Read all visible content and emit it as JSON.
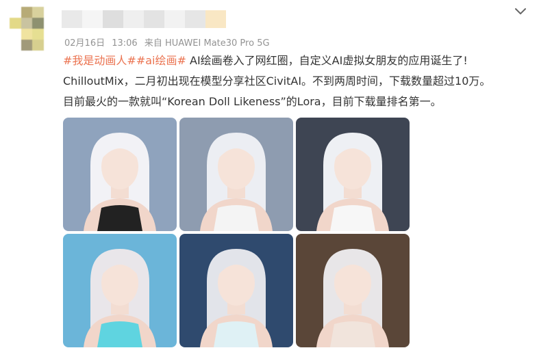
{
  "colors": {
    "tag": "#eb7350",
    "text": "#333333",
    "meta": "#939393"
  },
  "header": {
    "chevron_icon": "chevron-down-icon"
  },
  "meta": {
    "date": "02月16日",
    "time": "13:06",
    "source": "来自 HUAWEI Mate30 Pro 5G"
  },
  "post": {
    "tag1": "#我是动画人#",
    "tag2": "#ai绘画#",
    "line1_text": " AI绘画卷入了网红圈，自定义AI虚拟女朋友的应用诞生了!",
    "line2": "ChilloutMix，二月初出现在模型分享社区CivitAI。不到两周时间，下载数量超过10万。",
    "line3": "目前最火的一款就叫“Korean Doll Likeness”的Lora，目前下载量排名第一。"
  },
  "photos": [
    {
      "bg": "#8fa3bd",
      "hair": "#f2f2f6",
      "outfit": "#222222"
    },
    {
      "bg": "#8e9cb0",
      "hair": "#eceef3",
      "outfit": "#f4f4f4"
    },
    {
      "bg": "#3e4553",
      "hair": "#eef0f4",
      "outfit": "#f7f7f7"
    },
    {
      "bg": "#6bb5d9",
      "hair": "#e9e6ea",
      "outfit": "#5fd4e0"
    },
    {
      "bg": "#2f4a6e",
      "hair": "#e2e4ea",
      "outfit": "#dff1f5"
    },
    {
      "bg": "#5a4638",
      "hair": "#e8e6e8",
      "outfit": "#f1e4dc"
    }
  ]
}
